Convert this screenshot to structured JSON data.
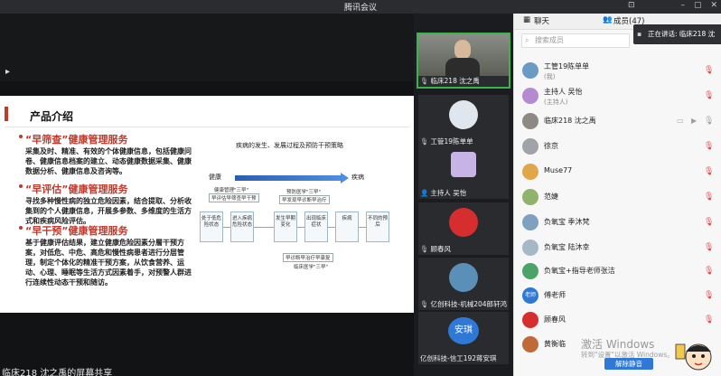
{
  "window": {
    "title": "腾讯会议",
    "controls": {
      "pin": "⊡",
      "minimize": "–",
      "maximize": "▢",
      "close": "✕"
    }
  },
  "share": {
    "sharer_label": "临床218 沈之禹的屏幕共享",
    "slide": {
      "title": "产品介绍",
      "sections": [
        {
          "heading": "“早筛查”健康管理服务",
          "body": "采集及时、精准、有效的个体健康信息，包括健康问卷、健康信息档案的建立、动态健康数据采集、健康数据分析、健康信息及咨询等。"
        },
        {
          "heading": "“早评估”健康管理服务",
          "body": "寻找多种慢性病的独立危险因素，结合提取、分析收集到的个人健康信息，开展多参数、多维度的生活方式和疾病风险评估。"
        },
        {
          "heading": "“早干预”健康管理服务",
          "body": "基于健康评估结果，建立健康危险因素分層干预方案，对低危、中危、高危和慢性病患者进行分层管理，制定个体化的精准干预方案，从饮食营养、运动、心理、睡眠等生活方式因素着手，对预警人群进行连续性动态干预和随访。"
        }
      ],
      "diagram": {
        "title": "疾病的发生、发展过程及预防干预策略",
        "start": "健康",
        "end": "疾病",
        "tags": {
          "health_mgmt": "健康管理\"三早\"",
          "early_screen": "早评估早筛查早干预",
          "prevention": "预防医学\"三早\"",
          "early_find": "早发现早诊断早治疗",
          "early_rehab": "早诊断早治疗早康复",
          "clinical": "临床医学\"三早\""
        },
        "stages": [
          "处于低危险状态",
          "进入疾病危险状态",
          "发生早期变化",
          "出现临床症状",
          "疾病",
          "不同的预后"
        ]
      }
    }
  },
  "videos": [
    {
      "name": "临床218 沈之禹",
      "active": true
    },
    {
      "name": "工管19陈单单",
      "active": false
    },
    {
      "name": "主持人 吴怡",
      "active": false
    },
    {
      "name": "顾春风",
      "active": false
    },
    {
      "name": "亿创科技-机械204郎轩鸿",
      "active": false
    },
    {
      "name": "亿创科技-信工192蒋安琪",
      "active": false,
      "avatar_text": "安琪"
    }
  ],
  "panel": {
    "tabs": {
      "chat": "聊天",
      "members": "成员(47)"
    },
    "speaking_label": "正在讲话: 临床218 沈",
    "search_placeholder": "搜索成员",
    "members": [
      {
        "name": "工管19陈单单",
        "sub": "(我)",
        "color": "#6b9ac4"
      },
      {
        "name": "主持人 吴怡",
        "sub": "(主持人)",
        "color": "#b48bd1"
      },
      {
        "name": "临床218 沈之禹",
        "sub": "",
        "color": "#8d8a83"
      },
      {
        "name": "徐京",
        "sub": "",
        "color": "#a0a4a8"
      },
      {
        "name": "Muse77",
        "sub": "",
        "color": "#e1a64a"
      },
      {
        "name": "范婕",
        "sub": "",
        "color": "#8fb36a"
      },
      {
        "name": "负氧宝 季沐梵",
        "sub": "",
        "color": "#7fa0c0"
      },
      {
        "name": "负氧宝 陆沐幸",
        "sub": "",
        "color": "#a5b8c6"
      },
      {
        "name": "负氧宝+指导老师张洁",
        "sub": "",
        "color": "#4ca36a"
      },
      {
        "name": "傅老师",
        "sub": "",
        "color": "#2f78d6",
        "avatar_text": "老师"
      },
      {
        "name": "顾春风",
        "sub": "",
        "color": "#d62e2e"
      },
      {
        "name": "黄衡临",
        "sub": "",
        "color": "#c06a3a"
      }
    ],
    "watermark_title": "激活 Windows",
    "watermark_sub": "转到\"设置\"以激活 Windows。",
    "unmute_button": "解除静音"
  }
}
